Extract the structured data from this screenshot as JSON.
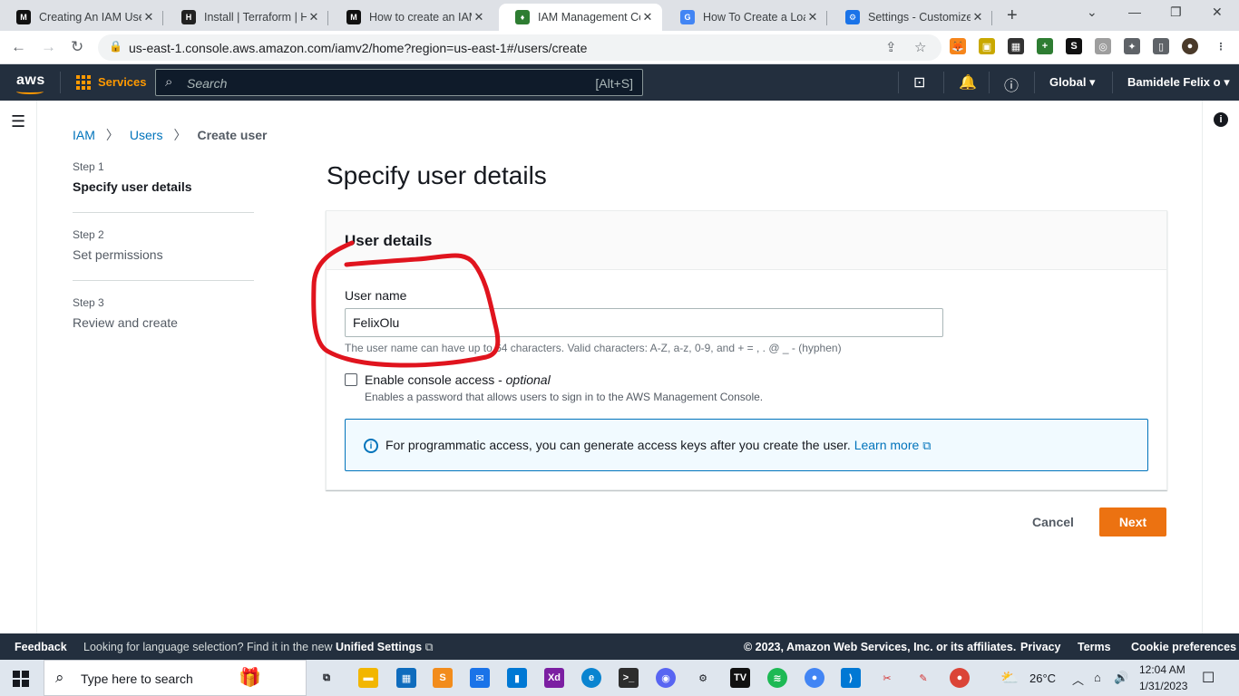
{
  "browser": {
    "tabs": [
      {
        "title": "Creating An IAM User",
        "favicon": "M",
        "color": "#111111"
      },
      {
        "title": "Install | Terraform | HashiCorp",
        "favicon": "H",
        "color": "#222222"
      },
      {
        "title": "How to create an IAM",
        "favicon": "M",
        "color": "#111111"
      },
      {
        "title": "IAM Management Console",
        "favicon": "IAM",
        "color": "#2e7d32"
      },
      {
        "title": "How To Create a Load",
        "favicon": "G",
        "color": "#4285f4"
      },
      {
        "title": "Settings - Customize",
        "favicon": "⚙",
        "color": "#1a73e8"
      }
    ],
    "new_tab": "+",
    "url": "us-east-1.console.aws.amazon.com/iamv2/home?region=us-east-1#/users/create"
  },
  "aws_nav": {
    "logo": "aws",
    "services": "Services",
    "search_placeholder": "Search",
    "search_hint": "[Alt+S]",
    "region": "Global ▾",
    "account": "Bamidele Felix o ▾"
  },
  "breadcrumb": [
    "IAM",
    "Users",
    "Create user"
  ],
  "steps": [
    {
      "num": "Step 1",
      "label": "Specify user details"
    },
    {
      "num": "Step 2",
      "label": "Set permissions"
    },
    {
      "num": "Step 3",
      "label": "Review and create"
    }
  ],
  "page_title": "Specify user details",
  "panel": {
    "heading": "User details",
    "username_label": "User name",
    "username_value": "FelixOlu",
    "username_help": "The user name can have up to 64 characters. Valid characters: A-Z, a-z, 0-9, and + = , . @ _ - (hyphen)",
    "console_label": "Enable console access - ",
    "console_optional": "optional",
    "console_desc": "Enables a password that allows users to sign in to the AWS Management Console.",
    "info_text": "For programmatic access, you can generate access keys after you create the user. ",
    "learn_more": "Learn more"
  },
  "buttons": {
    "cancel": "Cancel",
    "next": "Next"
  },
  "footer": {
    "feedback": "Feedback",
    "language": "Looking for language selection? Find it in the new ",
    "unified": "Unified Settings",
    "copyright": "© 2023, Amazon Web Services, Inc. or its affiliates.",
    "privacy": "Privacy",
    "terms": "Terms",
    "cookies": "Cookie preferences"
  },
  "taskbar": {
    "search": "Type here to search",
    "weather": "26°C",
    "time": "12:04 AM",
    "date": "1/31/2023"
  },
  "colors": {
    "aws_orange": "#ec7211",
    "aws_dark": "#232f3e",
    "link": "#0073bb",
    "annotation": "#e0141e"
  }
}
